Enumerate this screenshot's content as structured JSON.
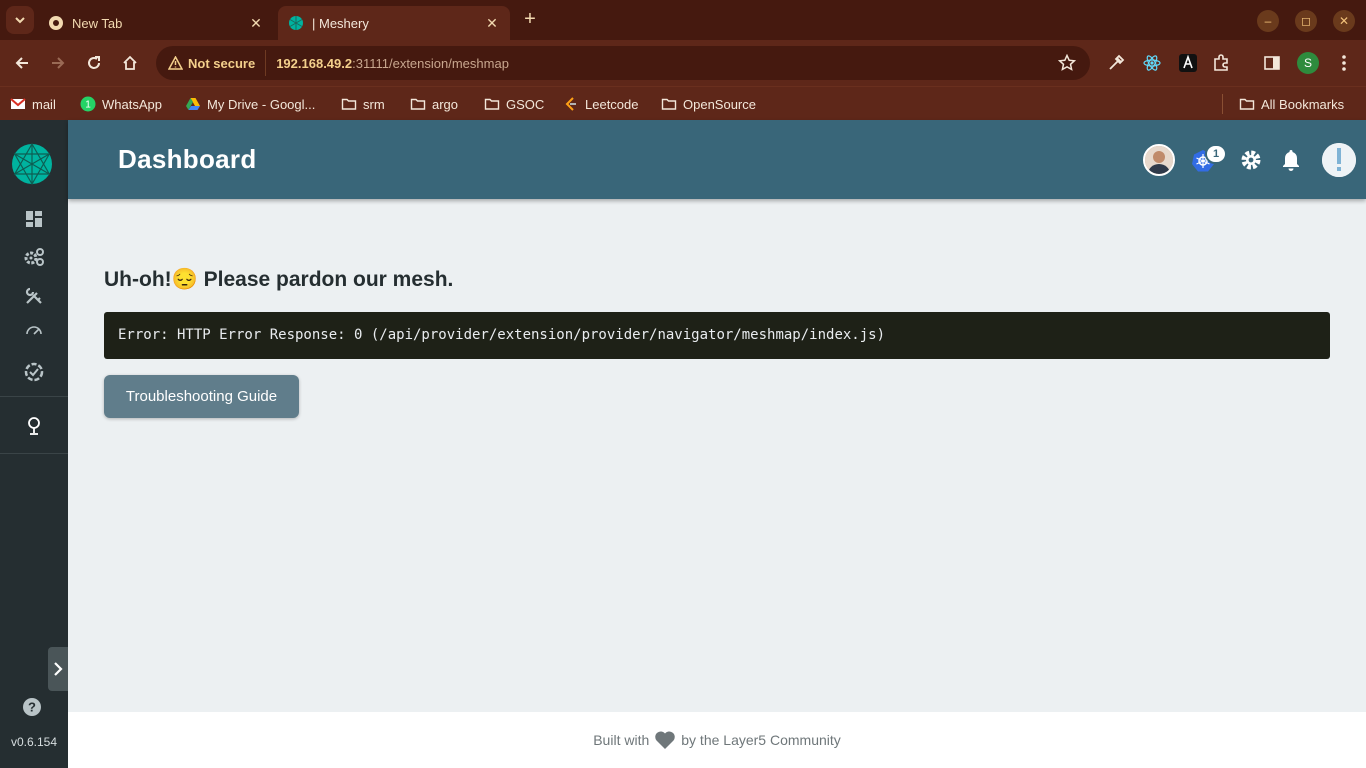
{
  "browser": {
    "tabs": [
      {
        "title": "New Tab"
      },
      {
        "title": "| Meshery"
      }
    ],
    "address": {
      "security_label": "Not secure",
      "url_host": "192.168.49.2",
      "url_rest": ":31111/extension/meshmap"
    },
    "profile_initial": "S",
    "bookmarks": [
      {
        "label": "mail"
      },
      {
        "label": "WhatsApp"
      },
      {
        "label": "My Drive - Googl..."
      },
      {
        "label": "srm"
      },
      {
        "label": "argo"
      },
      {
        "label": "GSOC"
      },
      {
        "label": "Leetcode"
      },
      {
        "label": "OpenSource"
      }
    ],
    "all_bookmarks": "All Bookmarks",
    "whatsapp_badge": "1"
  },
  "app": {
    "title": "Dashboard",
    "notification_count": "1",
    "version": "v0.6.154",
    "error": {
      "heading": "Uh-oh!😔 Please pardon our mesh.",
      "message": "Error: HTTP Error Response: 0 (/api/provider/extension/provider/navigator/meshmap/index.js)",
      "button_label": "Troubleshooting Guide"
    },
    "footer": {
      "before": "Built with",
      "after": "by the Layer5 Community"
    }
  },
  "colors": {
    "tabbar": "#45190f",
    "toolbar": "#5e2719",
    "sidebar": "#252e31",
    "appbar": "#396679",
    "content_bg": "#ecf0f2",
    "button": "#607d8b",
    "error_box": "#1e2117",
    "accent": "#00b39f"
  }
}
